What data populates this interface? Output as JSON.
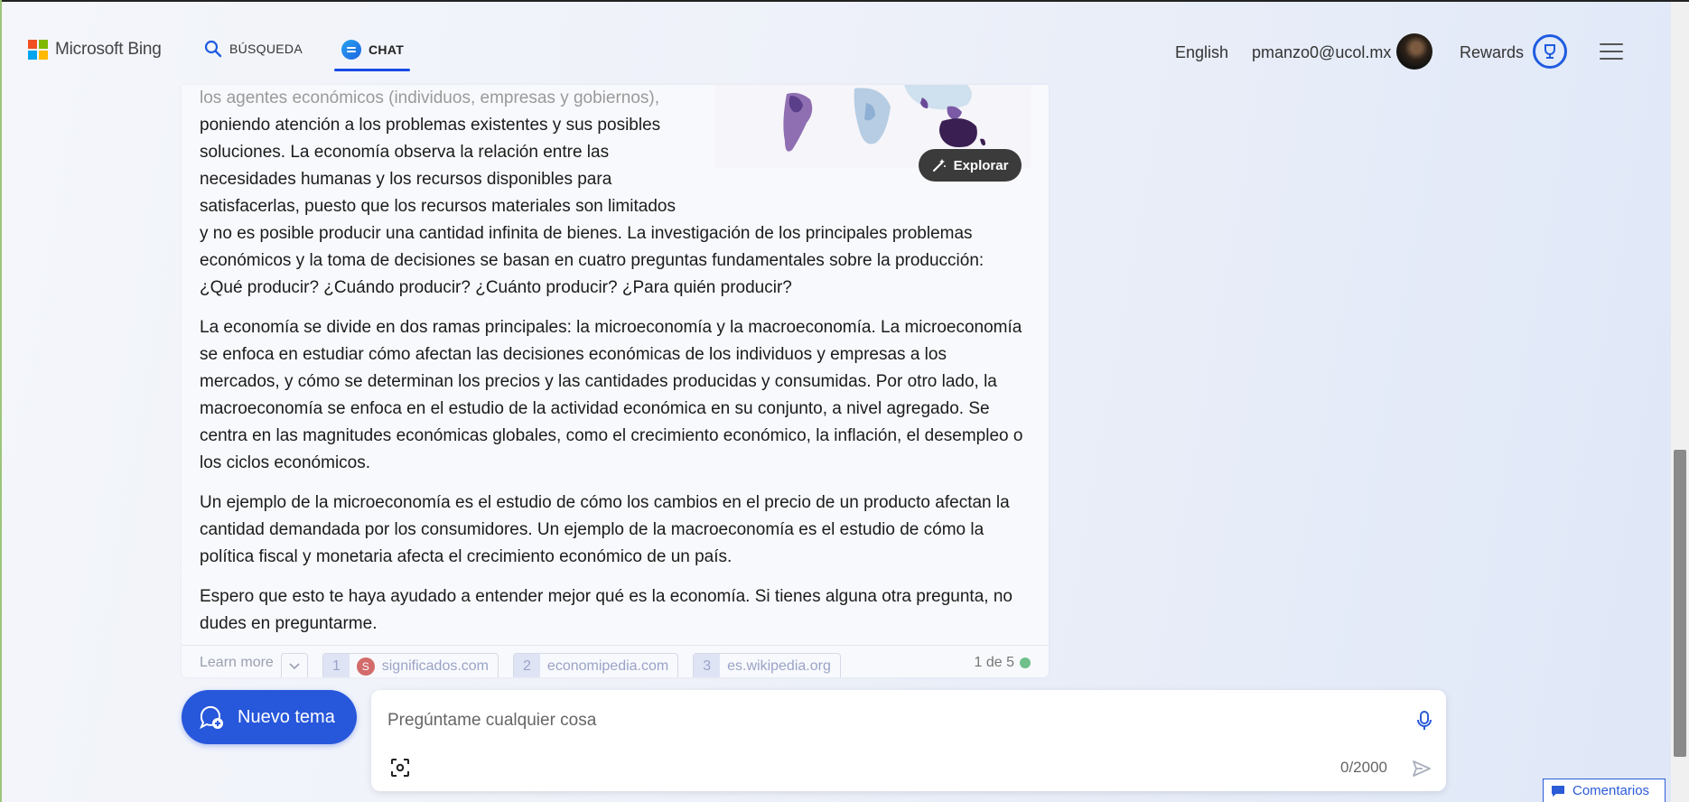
{
  "header": {
    "logo_text": "Microsoft Bing",
    "tabs": [
      {
        "label": "BÚSQUEDA",
        "icon": "search-icon"
      },
      {
        "label": "CHAT",
        "icon": "chat-icon",
        "active": true
      }
    ],
    "language": "English",
    "user_email": "pmanzo0@ucol.mx",
    "rewards_label": "Rewards"
  },
  "answer": {
    "wrapped_lines": [
      "los agentes económicos (individuos, empresas y gobiernos),",
      "poniendo atención a los problemas existentes y sus posibles",
      "soluciones. La economía observa la relación entre las",
      "necesidades humanas y los recursos disponibles para",
      "satisfacerlas, puesto que los recursos materiales son limitados"
    ],
    "continuation": "y no es posible producir una cantidad infinita de bienes. La investigación de los principales problemas económicos y la toma de decisiones se basan en cuatro preguntas fundamentales sobre la producción: ¿Qué producir? ¿Cuándo producir? ¿Cuánto producir? ¿Para quién producir?",
    "paragraphs": [
      "La economía se divide en dos ramas principales: la microeconomía y la macroeconomía. La microeconomía se enfoca en estudiar cómo afectan las decisiones económicas de los individuos y empresas a los mercados, y cómo se determinan los precios y las cantidades producidas y consumidas. Por otro lado, la macroeconomía se enfoca en el estudio de la actividad económica en su conjunto, a nivel agregado. Se centra en las magnitudes económicas globales, como el crecimiento económico, la inflación, el desempleo o los ciclos económicos.",
      "Un ejemplo de la microeconomía es el estudio de cómo los cambios en el precio de un producto afectan la cantidad demandada por los consumidores. Un ejemplo de la macroeconomía es el estudio de cómo la política fiscal y monetaria afecta el crecimiento económico de un país.",
      "Espero que esto te haya ayudado a entender mejor qué es la economía. Si tienes alguna otra pregunta, no dudes en preguntarme."
    ],
    "explore_label": "Explorar",
    "learn_more_label": "Learn more",
    "citations": [
      {
        "num": "1",
        "source": "significados.com"
      },
      {
        "num": "2",
        "source": "economipedia.com"
      },
      {
        "num": "3",
        "source": "es.wikipedia.org"
      }
    ],
    "response_count": "1 de 5"
  },
  "composer": {
    "new_topic_label": "Nuevo tema",
    "placeholder": "Pregúntame cualquier cosa",
    "char_count": "0/2000"
  },
  "feedback_label": "Comentarios",
  "colors": {
    "accent": "#2757db",
    "chat_tab_underline": "#174ae4"
  }
}
